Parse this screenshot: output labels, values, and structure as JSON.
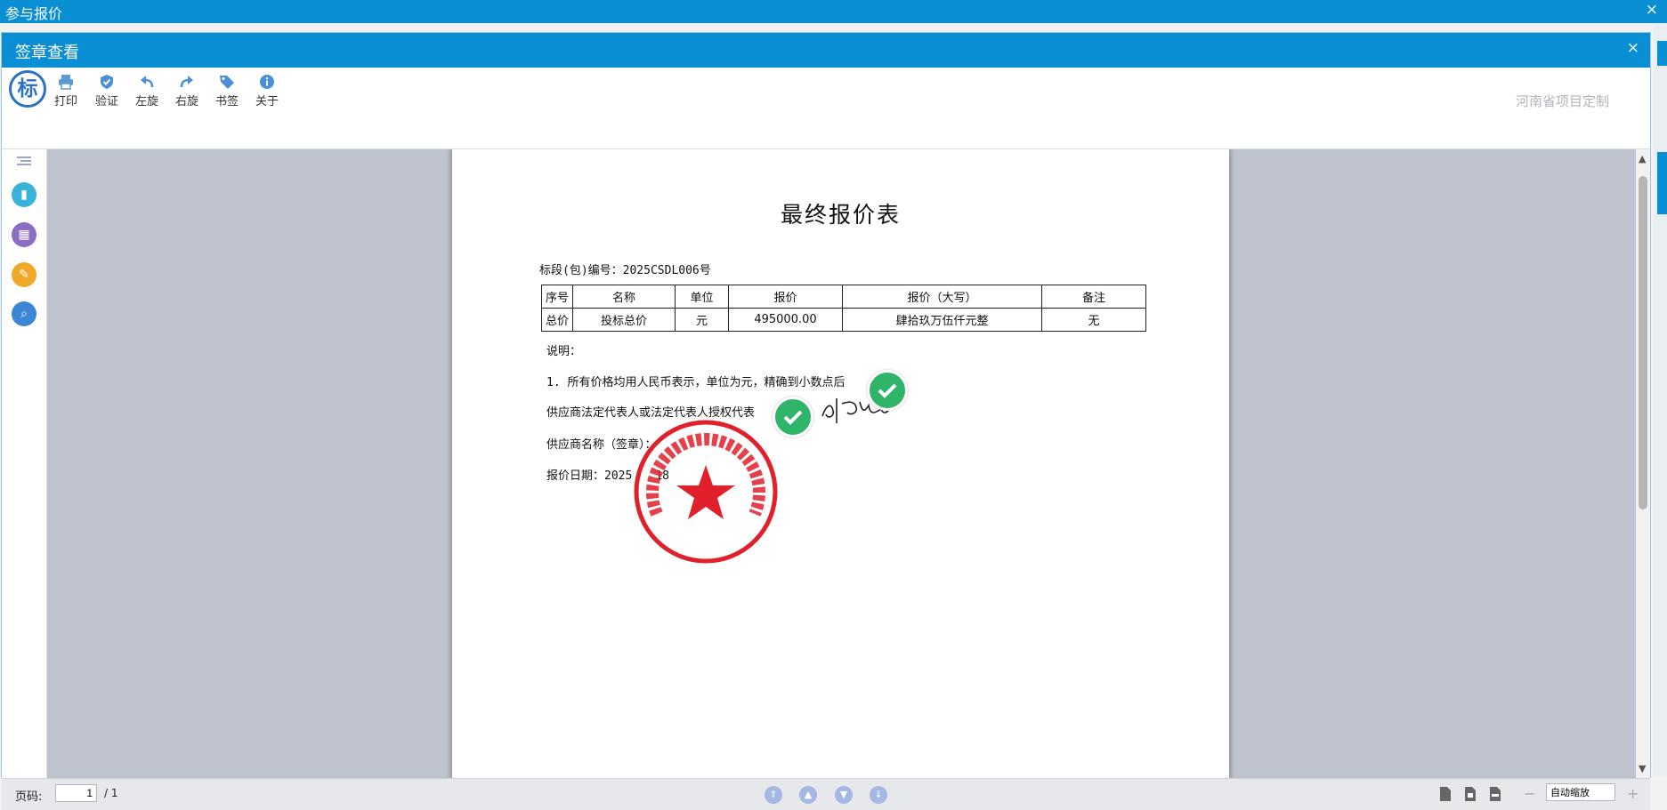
{
  "outer": {
    "title": "参与报价",
    "close": "×"
  },
  "dialog": {
    "title": "签章查看",
    "close": "×"
  },
  "toolbar": {
    "logo": "标",
    "items": [
      {
        "label": "打印",
        "icon": "printer-icon"
      },
      {
        "label": "验证",
        "icon": "shield-check-icon"
      },
      {
        "label": "左旋",
        "icon": "rotate-left-icon"
      },
      {
        "label": "右旋",
        "icon": "rotate-right-icon"
      },
      {
        "label": "书签",
        "icon": "bookmark-tag-icon"
      },
      {
        "label": "关于",
        "icon": "info-icon"
      }
    ],
    "brand": "河南省项目定制"
  },
  "sidebar": {
    "items": [
      {
        "icon": "outline-list-icon",
        "color": "#9aa7c7"
      },
      {
        "icon": "page-icon",
        "color": "#38b3d9"
      },
      {
        "icon": "grid-thumbnails-icon",
        "color": "#8b6dc4"
      },
      {
        "icon": "pen-icon",
        "color": "#f0a928"
      },
      {
        "icon": "search-icon",
        "color": "#3d86d6"
      }
    ]
  },
  "document": {
    "title": "最终报价表",
    "package_line": "标段(包)编号：2025CSDL006号",
    "table": {
      "headers": [
        "序号",
        "名称",
        "单位",
        "报价",
        "报价（大写）",
        "备注"
      ],
      "rows": [
        [
          "总价",
          "投标总价",
          "元",
          "495000.00",
          "肆拾玖万伍仟元整",
          "无"
        ]
      ]
    },
    "note_heading": "说明：",
    "note_1": "1. 所有价格均用人民币表示，单位为元，精确到小数点后",
    "rep_line": "供应商法定代表人或法定代表人授权代表",
    "supplier_line": "供应商名称（签章）：",
    "date_line": "报价日期：2025",
    "date_suffix": "18",
    "stamp_text": "中国电信股份有限公司",
    "signature": "刘凤凯"
  },
  "status": {
    "page_label": "页码:",
    "page_value": "1",
    "page_total": "/ 1",
    "zoom": "自动缩放",
    "zoom_minus": "−",
    "zoom_plus": "+"
  },
  "colors": {
    "titlebar": "#0a8fd4",
    "viewer_bg": "#bfc3ce",
    "stamp_red": "#e0202a",
    "check_green": "#2fb56a"
  }
}
